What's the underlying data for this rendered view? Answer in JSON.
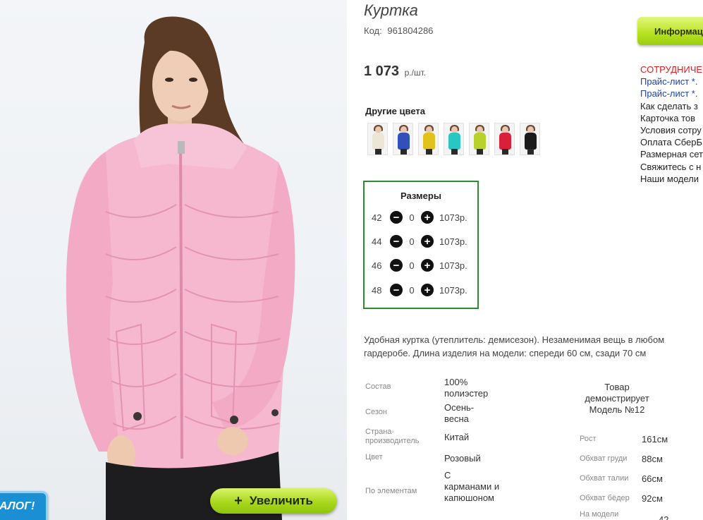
{
  "product": {
    "title": "Куртка",
    "code_label": "Код:",
    "code": "961804286",
    "price": "1 073",
    "price_unit": "р./шт."
  },
  "other_colors": {
    "title": "Другие цвета",
    "swatches": [
      {
        "name": "beige",
        "color": "#ece6d6"
      },
      {
        "name": "blue",
        "color": "#3350b8"
      },
      {
        "name": "yellow",
        "color": "#e0c21a"
      },
      {
        "name": "turquoise",
        "color": "#29c7c2"
      },
      {
        "name": "lime",
        "color": "#b8d12c"
      },
      {
        "name": "red",
        "color": "#d8203a"
      },
      {
        "name": "black",
        "color": "#1b1b1b"
      }
    ]
  },
  "sizes": {
    "title": "Размеры",
    "rows": [
      {
        "size": "42",
        "qty": "0",
        "price": "1073р."
      },
      {
        "size": "44",
        "qty": "0",
        "price": "1073р."
      },
      {
        "size": "46",
        "qty": "0",
        "price": "1073р."
      },
      {
        "size": "48",
        "qty": "0",
        "price": "1073р."
      }
    ],
    "minus_symbol": "−",
    "plus_symbol": "+"
  },
  "description": "Удобная куртка (утеплитель: демисезон). Незаменимая вещь в любом гардеробе. Длина изделия на модели: спереди 60 см, сзади 70 см",
  "specs": [
    {
      "label": "Состав",
      "value": "100% полиэстер"
    },
    {
      "label": "Сезон",
      "value": "Осень-весна"
    },
    {
      "label": "Страна-производитель",
      "value": "Китай"
    },
    {
      "label": "Цвет",
      "value": "Розовый"
    },
    {
      "label": "По элементам",
      "value": "С карманами и капюшоном"
    }
  ],
  "model": {
    "title": "Товар демонстрирует Модель №12",
    "params": [
      {
        "label": "Рост",
        "value": "161см"
      },
      {
        "label": "Обхват груди",
        "value": "88см"
      },
      {
        "label": "Обхват талии",
        "value": "66см"
      },
      {
        "label": "Обхват бёдер",
        "value": "92см"
      },
      {
        "label": "На модели",
        "value": "42"
      }
    ]
  },
  "gallery": {
    "zoom_label": "Увеличить",
    "zoom_symbol": "+",
    "catalog_badge": "АЛОГ!"
  },
  "sidebar": {
    "info_button": "Информац",
    "links": [
      {
        "text": "СОТРУДНИЧЕС",
        "color": "red"
      },
      {
        "text": "Прайс-лист *.",
        "color": "blue"
      },
      {
        "text": "Прайс-лист *.",
        "color": "blue"
      },
      {
        "text": "Как сделать з",
        "color": "dark"
      },
      {
        "text": "Карточка тов",
        "color": "dark"
      },
      {
        "text": "Условия сотру",
        "color": "dark"
      },
      {
        "text": "Оплата СберБ",
        "color": "dark"
      },
      {
        "text": "Размерная сет",
        "color": "dark"
      },
      {
        "text": "Свяжитесь с н",
        "color": "dark"
      },
      {
        "text": "Наши модели",
        "color": "dark"
      }
    ]
  },
  "colors": {
    "accent_green": "#2e8b2e",
    "button_lime": "#a9d81c",
    "jacket_pink": "#f6b8cf"
  }
}
